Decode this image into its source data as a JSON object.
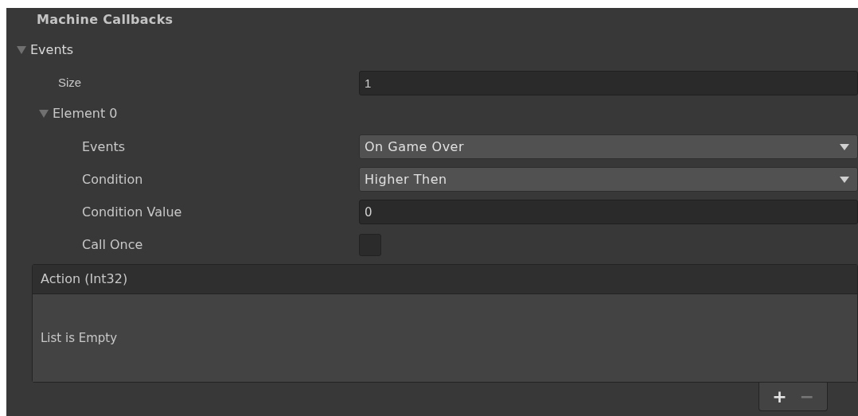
{
  "header": {
    "title": "Machine Callbacks"
  },
  "events": {
    "label": "Events",
    "expanded": true,
    "size": {
      "label": "Size",
      "value": "1"
    },
    "elements": [
      {
        "label": "Element 0",
        "expanded": true,
        "fields": [
          {
            "kind": "dropdown",
            "label": "Events",
            "value": "On Game Over"
          },
          {
            "kind": "dropdown",
            "label": "Condition",
            "value": "Higher Then"
          },
          {
            "kind": "number",
            "label": "Condition Value",
            "value": "0"
          },
          {
            "kind": "checkbox",
            "label": "Call Once",
            "checked": false
          }
        ],
        "action": {
          "title": "Action (Int32)",
          "empty_text": "List is Empty",
          "buttons": [
            {
              "label": "+",
              "disabled": false
            },
            {
              "label": "−",
              "disabled": true
            }
          ]
        }
      }
    ]
  }
}
